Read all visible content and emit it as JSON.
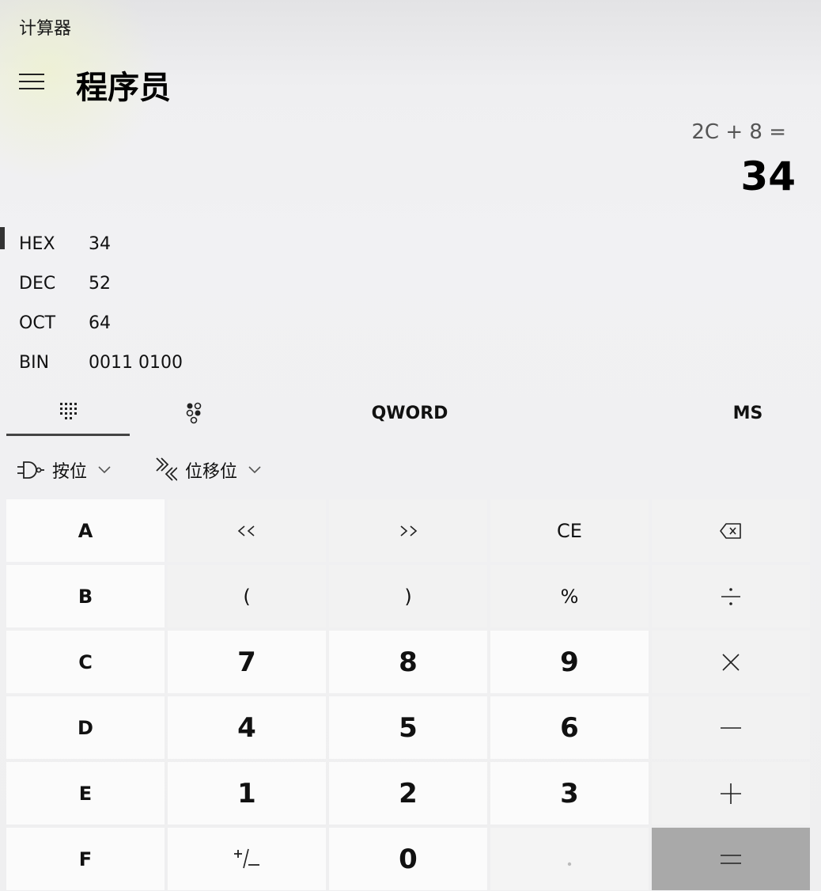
{
  "app": {
    "title": "计算器"
  },
  "header": {
    "menu_icon": "hamburger-icon",
    "mode": "程序员"
  },
  "display": {
    "expression": "2C + 8 =",
    "result": "34"
  },
  "radix": [
    {
      "name": "HEX",
      "value": "34",
      "selected": true
    },
    {
      "name": "DEC",
      "value": "52",
      "selected": false
    },
    {
      "name": "OCT",
      "value": "64",
      "selected": false
    },
    {
      "name": "BIN",
      "value": "0011 0100",
      "selected": false
    }
  ],
  "tabs": {
    "keypad_icon": "full-keypad-icon",
    "bits_icon": "bit-toggling-keypad-icon",
    "word_size": "QWORD",
    "memory_store": "MS"
  },
  "operators": {
    "bitwise_label": "按位",
    "bitshift_label": "位移位"
  },
  "keys": [
    [
      "A",
      "<<",
      ">>",
      "CE",
      "backspace"
    ],
    [
      "B",
      "(",
      ")",
      "%",
      "÷"
    ],
    [
      "C",
      "7",
      "8",
      "9",
      "×"
    ],
    [
      "D",
      "4",
      "5",
      "6",
      "−"
    ],
    [
      "E",
      "1",
      "2",
      "3",
      "+"
    ],
    [
      "F",
      "+/−",
      "0",
      ".",
      "="
    ]
  ],
  "colors": {
    "equals_key": "#a9a9a9",
    "selected_indicator": "#333333"
  }
}
